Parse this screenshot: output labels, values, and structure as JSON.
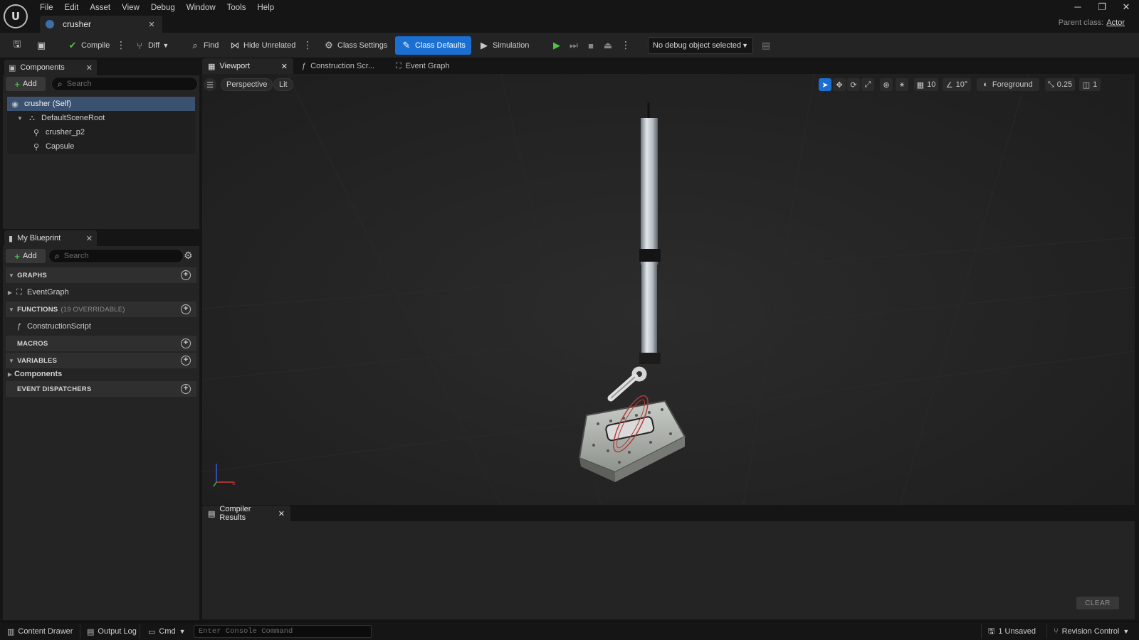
{
  "app": {
    "logo_text": "U",
    "menu": [
      "File",
      "Edit",
      "Asset",
      "View",
      "Debug",
      "Window",
      "Tools",
      "Help"
    ],
    "document_tab": "crusher",
    "parent_class_label": "Parent class:",
    "parent_class_value": "Actor"
  },
  "toolbar": {
    "compile": "Compile",
    "diff": "Diff",
    "find": "Find",
    "hide_unrelated": "Hide Unrelated",
    "class_settings": "Class Settings",
    "class_defaults": "Class Defaults",
    "simulation": "Simulation",
    "debug_object": "No debug object selected"
  },
  "components_panel": {
    "title": "Components",
    "add_label": "Add",
    "search_placeholder": "Search",
    "tree": [
      {
        "label": "crusher (Self)",
        "selected": true
      },
      {
        "label": "DefaultSceneRoot"
      },
      {
        "label": "crusher_p2"
      },
      {
        "label": "Capsule"
      }
    ]
  },
  "my_blueprint": {
    "title": "My Blueprint",
    "add_label": "Add",
    "search_placeholder": "Search",
    "graphs_header": "GRAPHS",
    "event_graph": "EventGraph",
    "functions_header": "FUNCTIONS",
    "functions_count": "(19 OVERRIDABLE)",
    "construction_script": "ConstructionScript",
    "macros_header": "MACROS",
    "variables_header": "VARIABLES",
    "components_item": "Components",
    "event_dispatchers_header": "EVENT DISPATCHERS"
  },
  "viewport": {
    "tabs": [
      "Viewport",
      "Construction Scr...",
      "Event Graph"
    ],
    "perspective": "Perspective",
    "lit": "Lit",
    "grid_snap": "10",
    "rotation_snap": "10°",
    "layer": "Foreground",
    "scale_snap": "0.25",
    "camera_speed": "1"
  },
  "compiler": {
    "title": "Compiler Results",
    "clear_label": "CLEAR"
  },
  "statusbar": {
    "content_drawer": "Content Drawer",
    "output_log": "Output Log",
    "cmd": "Cmd",
    "console_placeholder": "Enter Console Command",
    "unsaved": "1 Unsaved",
    "revision_control": "Revision Control"
  },
  "colors": {
    "accent": "#1a6fd1",
    "selection": "#3b5170",
    "play": "#53c046",
    "panel": "#242424",
    "background": "#151515"
  }
}
